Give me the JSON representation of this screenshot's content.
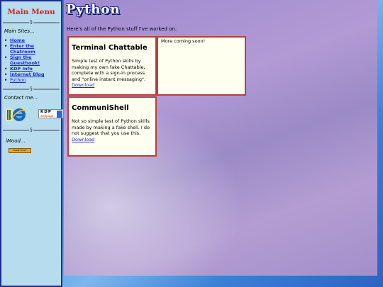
{
  "sidebar": {
    "title": "Main Menu",
    "divider_glyph": "§",
    "main_sites_label": "Main Sites...",
    "nav": [
      {
        "label": "Home"
      },
      {
        "label": "Enter the Chatroom"
      },
      {
        "label": "Sign the Guestbook!"
      },
      {
        "label": "KDP Info"
      },
      {
        "label": "Internet Blog"
      },
      {
        "label": "Python"
      }
    ],
    "contact_label": "Contact me...",
    "kdp_badge": {
      "line1": "KDP",
      "line2": "webpage"
    },
    "imood_label": "iMood...",
    "imood_bar_text": "Sweet Smart"
  },
  "main": {
    "logo_text": "Python",
    "intro": "Here's all of the Python stuff I've worked on.",
    "cards": [
      {
        "title": "Terminal Chattable",
        "description": "Simple test of Python skills by making my own fake Chattable, complete with a sign-in process and \"online instant messaging\".",
        "link": "Download"
      },
      {
        "text": "More coming soon!"
      },
      {
        "title": "CommuniShell",
        "description": "Not so simple test of Python skills made by making a fake shell. I do not suggest that you use this.",
        "link": "Download"
      }
    ]
  },
  "colors": {
    "sidebar_bg": "#b6dcee",
    "sidebar_border": "#1d2f8a",
    "title_red": "#d8222a",
    "link_blue": "#1a2bd0",
    "card_bg": "#fffff0",
    "card_border": "#b54040"
  }
}
